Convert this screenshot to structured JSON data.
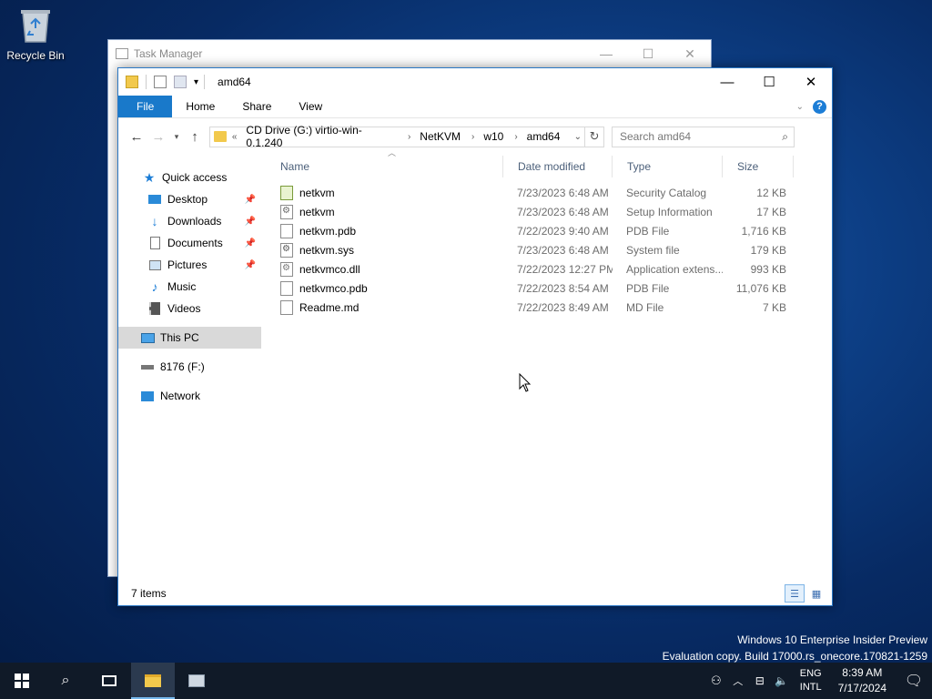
{
  "desktop": {
    "recycle_bin_label": "Recycle Bin"
  },
  "task_manager": {
    "title": "Task Manager"
  },
  "explorer": {
    "title": "amd64",
    "ribbon_tabs": [
      "File",
      "Home",
      "Share",
      "View"
    ],
    "breadcrumb": {
      "overflow": "«",
      "crumbs": [
        "CD Drive (G:) virtio-win-0.1.240",
        "NetKVM",
        "w10",
        "amd64"
      ]
    },
    "search_placeholder": "Search amd64",
    "nav_pane": {
      "quick_access": "Quick access",
      "pinned": [
        {
          "label": "Desktop",
          "icon": "desktop-icon",
          "pinned": true
        },
        {
          "label": "Downloads",
          "icon": "downloads-icon",
          "pinned": true
        },
        {
          "label": "Documents",
          "icon": "documents-icon",
          "pinned": true
        },
        {
          "label": "Pictures",
          "icon": "pictures-icon",
          "pinned": true
        },
        {
          "label": "Music",
          "icon": "music-icon",
          "pinned": false
        },
        {
          "label": "Videos",
          "icon": "videos-icon",
          "pinned": false
        }
      ],
      "this_pc": "This PC",
      "drive": "8176 (F:)",
      "network": "Network"
    },
    "columns": {
      "name": "Name",
      "date": "Date modified",
      "type": "Type",
      "size": "Size"
    },
    "files": [
      {
        "name": "netkvm",
        "date": "7/23/2023 6:48 AM",
        "type": "Security Catalog",
        "size": "12 KB",
        "icon": "security-catalog-icon"
      },
      {
        "name": "netkvm",
        "date": "7/23/2023 6:48 AM",
        "type": "Setup Information",
        "size": "17 KB",
        "icon": "setup-info-icon"
      },
      {
        "name": "netkvm.pdb",
        "date": "7/22/2023 9:40 AM",
        "type": "PDB File",
        "size": "1,716 KB",
        "icon": "file-icon"
      },
      {
        "name": "netkvm.sys",
        "date": "7/23/2023 6:48 AM",
        "type": "System file",
        "size": "179 KB",
        "icon": "system-file-icon"
      },
      {
        "name": "netkvmco.dll",
        "date": "7/22/2023 12:27 PM",
        "type": "Application extens...",
        "size": "993 KB",
        "icon": "dll-file-icon"
      },
      {
        "name": "netkvmco.pdb",
        "date": "7/22/2023 8:54 AM",
        "type": "PDB File",
        "size": "11,076 KB",
        "icon": "file-icon"
      },
      {
        "name": "Readme.md",
        "date": "7/22/2023 8:49 AM",
        "type": "MD File",
        "size": "7 KB",
        "icon": "file-icon"
      }
    ],
    "status": "7 items"
  },
  "watermark": {
    "line1": "Windows 10 Enterprise Insider Preview",
    "line2": "Evaluation copy. Build 17000.rs_onecore.170821-1259"
  },
  "taskbar": {
    "lang_top": "ENG",
    "lang_bottom": "INTL",
    "time": "8:39 AM",
    "date": "7/17/2024"
  },
  "colors": {
    "accent": "#1979ca",
    "selection": "#d9d9d9",
    "taskbar": "#101a28"
  }
}
